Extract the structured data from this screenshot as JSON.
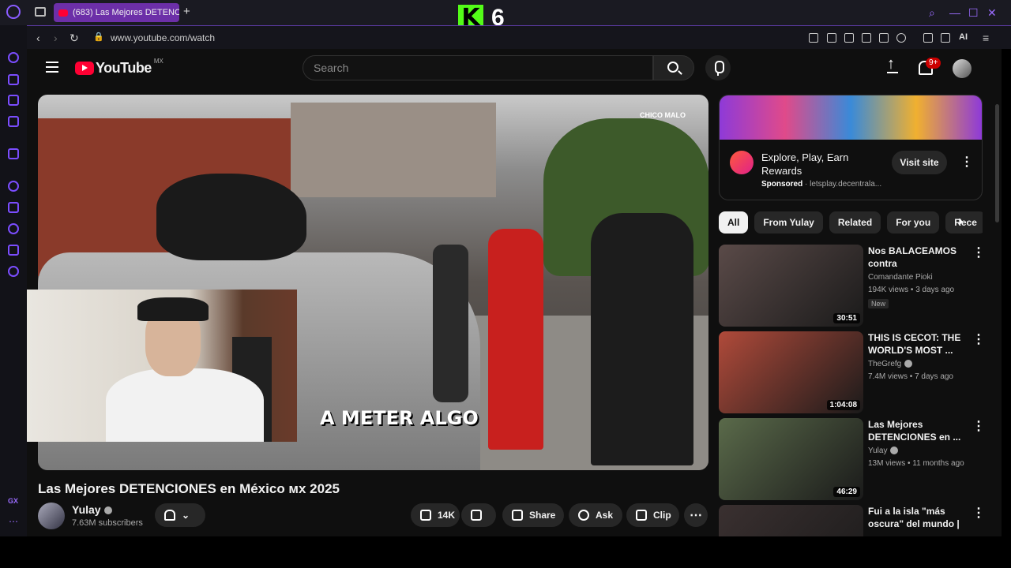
{
  "browser": {
    "tab_title": "(683) Las Mejores DETENC",
    "url": "www.youtube.com/watch",
    "overlay_k": "K",
    "overlay_num": "6",
    "ai_label": "AI",
    "gx_label": "GX"
  },
  "youtube": {
    "logo_text": "YouTube",
    "country_code": "MX",
    "search_placeholder": "Search",
    "notif_badge": "9+"
  },
  "player": {
    "caption": "A METER ALGO",
    "watermark": "CHICO MALO"
  },
  "video": {
    "title": "Las Mejores DETENCIONES en México ᴍx 2025",
    "channel": "Yulay",
    "subscribers": "7.63M subscribers",
    "likes": "14K",
    "share": "Share",
    "ask": "Ask",
    "clip": "Clip"
  },
  "ad": {
    "title": "Explore, Play, Earn Rewards",
    "sponsored": "Sponsored",
    "domain": "letsplay.decentrala...",
    "visit": "Visit site"
  },
  "chips": [
    "All",
    "From Yulay",
    "Related",
    "For you",
    "Rece"
  ],
  "recommendations": [
    {
      "title": "Nos BALACEAMOS contra \"VENDEDORES...",
      "channel": "Comandante Pioki",
      "meta": "194K views • 3 days ago",
      "badge": "New",
      "duration": "30:51",
      "color": "#5a4a48"
    },
    {
      "title": "THIS IS CECOT: THE WORLD'S MOST ...",
      "channel": "TheGrefg",
      "meta": "7.4M views • 7 days ago",
      "badge": "",
      "duration": "1:04:08",
      "color": "#b04a3a"
    },
    {
      "title": "Las Mejores DETENCIONES en ...",
      "channel": "Yulay",
      "meta": "13M views • 11 months ago",
      "badge": "",
      "duration": "46:29",
      "color": "#5a6a4a"
    },
    {
      "title": "Fui a la isla \"más oscura\" del mundo | ...",
      "channel": "",
      "meta": "",
      "badge": "",
      "duration": "",
      "color": "#3a3030"
    }
  ]
}
